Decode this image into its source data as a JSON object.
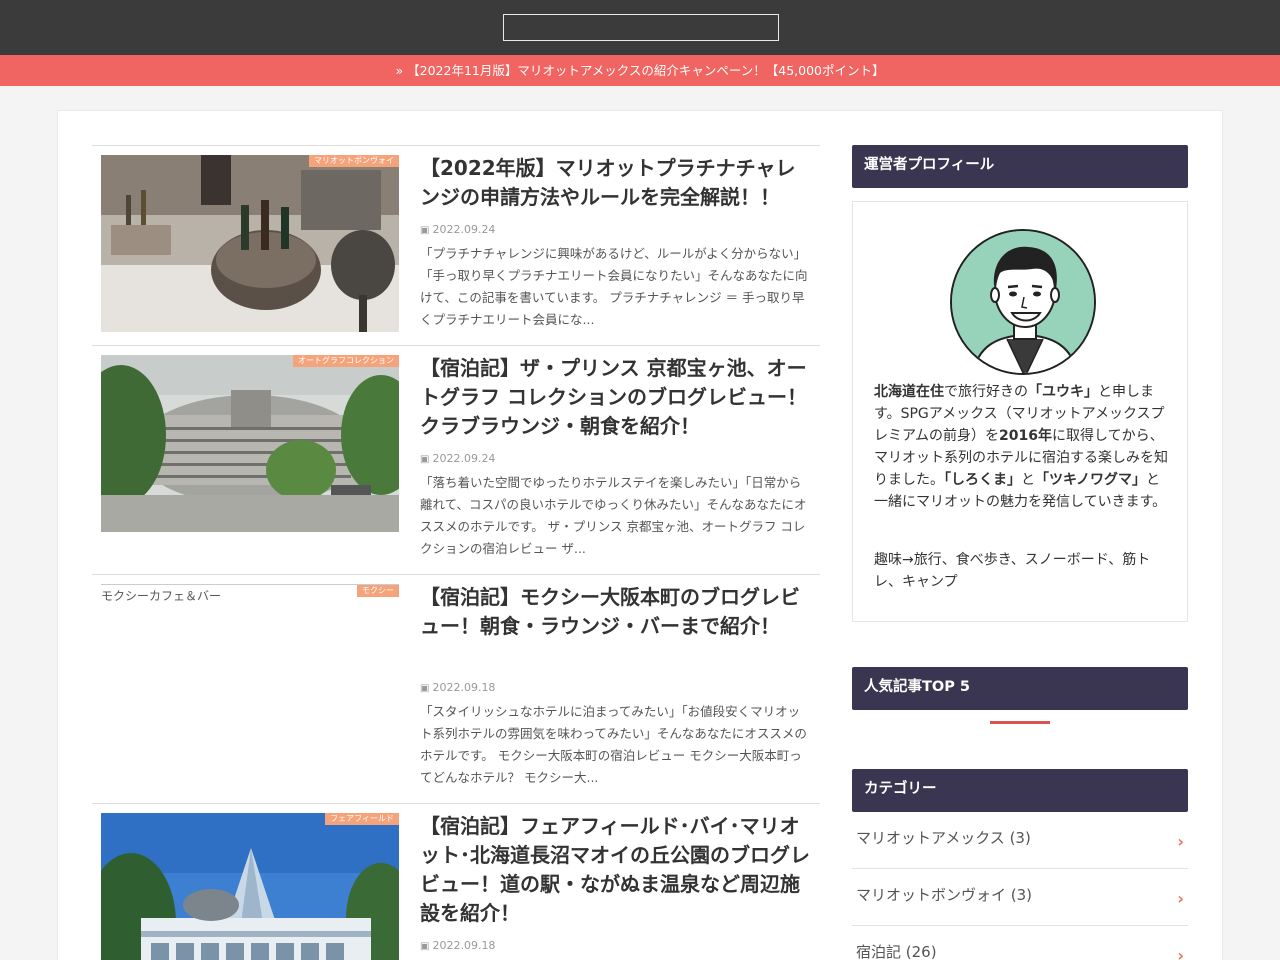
{
  "header": {
    "search_placeholder": ""
  },
  "notice": {
    "text": "【2022年11月版】マリオットアメックスの紹介キャンペーン！【45,000ポイント】"
  },
  "articles": [
    {
      "category": "マリオットボンヴォイ",
      "title": "【2022年版】マリオットプラチナチャレンジの申請方法やルールを完全解説！！",
      "date": "2022.09.24",
      "excerpt": "「プラチナチャレンジに興味があるけど、ルールがよく分からない」「手っ取り早くプラチナエリート会員になりたい」そんなあなたに向けて、この記事を書いています。 プラチナチャレンジ ＝ 手っ取り早くプラチナエリート会員にな..."
    },
    {
      "category": "オートグラフコレクション",
      "title": "【宿泊記】ザ・プリンス 京都宝ヶ池、オートグラフ コレクションのブログレビュー！クラブラウンジ・朝食を紹介！",
      "date": "2022.09.24",
      "excerpt": "「落ち着いた空間でゆったりホテルステイを楽しみたい」「日常から離れて、コスパの良いホテルでゆっくり休みたい」そんなあなたにオススメのホテルです。 ザ・プリンス 京都宝ヶ池、オートグラフ コレクションの宿泊レビュー ザ..."
    },
    {
      "category": "モクシー",
      "image_alt": "モクシーカフェ＆バー",
      "title": "【宿泊記】モクシー大阪本町のブログレビュー！朝食・ラウンジ・バーまで紹介！",
      "date": "2022.09.18",
      "excerpt": "「スタイリッシュなホテルに泊まってみたい」「お値段安くマリオット系列ホテルの雰囲気を味わってみたい」そんなあなたにオススメのホテルです。 モクシー大阪本町の宿泊レビュー モクシー大阪本町ってどんなホテル？ モクシー大..."
    },
    {
      "category": "フェアフィールド",
      "title": "【宿泊記】フェアフィールド･バイ･マリオット･北海道長沼マオイの丘公園のブログレビュー！道の駅・ながぬま温泉など周辺施設を紹介！",
      "date": "2022.09.18",
      "excerpt": ""
    }
  ],
  "sidebar": {
    "profile_heading": "運営者プロフィール",
    "profile_parts": {
      "p1": "北海道在住",
      "p2": "で旅行好きの",
      "p3": "「ユウキ」",
      "p4": "と申します。SPGアメックス（マリオットアメックスプレミアムの前身）を",
      "p5": "2016年",
      "p6": "に取得してから、マリオット系列のホテルに宿泊する楽しみを知りました。",
      "p7": "「しろくま」",
      "p8": "と",
      "p9": "「ツキノワグマ」",
      "p10": "と一緒にマリオットの魅力を発信していきます。"
    },
    "hobby": "趣味→旅行、食べ歩き、スノーボード、筋トレ、キャンプ",
    "popular_heading": "人気記事TOP 5",
    "category_heading": "カテゴリー",
    "categories": [
      {
        "label": "マリオットアメックス (3)"
      },
      {
        "label": "マリオットボンヴォイ (3)"
      },
      {
        "label": "宿泊記 (26)"
      }
    ]
  }
}
